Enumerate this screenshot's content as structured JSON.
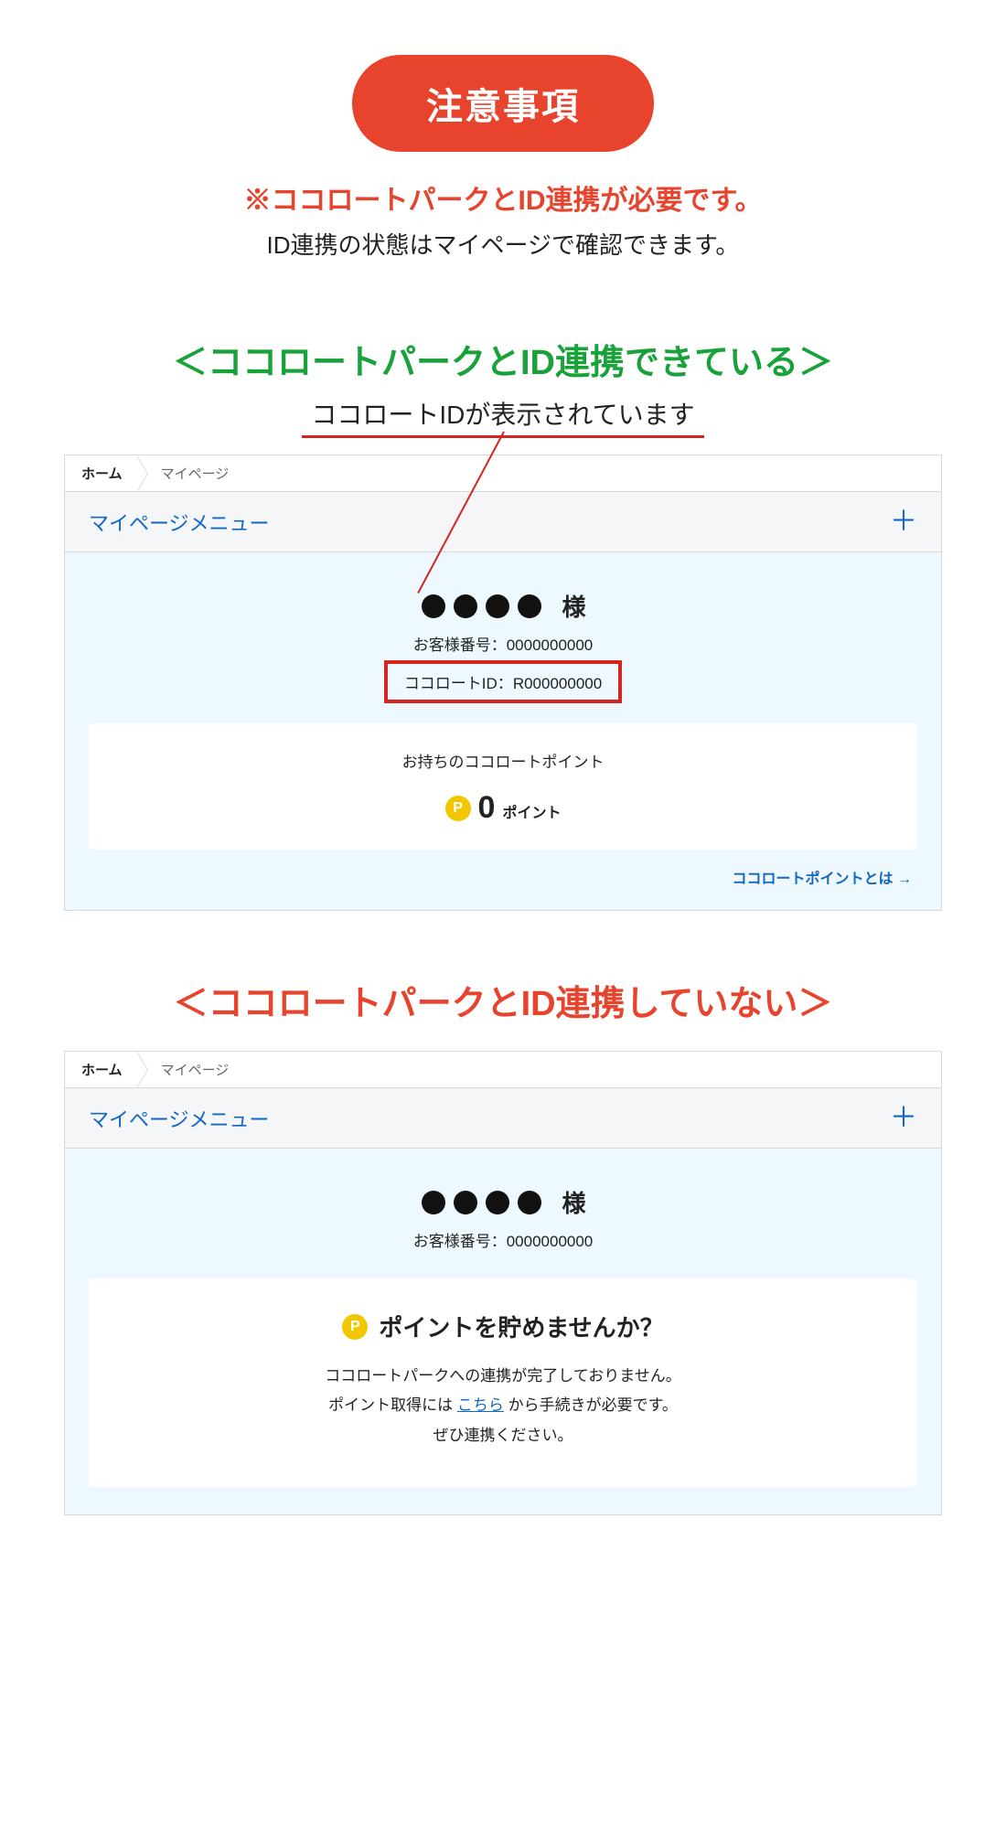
{
  "header": {
    "badge": "注意事項",
    "notice_red": "※ココロートパークとID連携が必要です。",
    "notice_black": "ID連携の状態はマイページで確認できます。"
  },
  "linked": {
    "title": "＜ココロートパークとID連携できている＞",
    "callout": "ココロートIDが表示されています",
    "breadcrumb": {
      "home": "ホーム",
      "current": "マイページ"
    },
    "menu_label": "マイページメニュー",
    "name_suffix": "様",
    "customer_number_label": "お客様番号：",
    "customer_number": "0000000000",
    "cocorohto_id_label": "ココロートID：",
    "cocorohto_id": "R000000000",
    "points_card_title": "お持ちのココロートポイント",
    "points_badge": "P",
    "points_value": "0",
    "points_unit": "ポイント",
    "points_link": "ココロートポイントとは →"
  },
  "not_linked": {
    "title": "＜ココロートパークとID連携していない＞",
    "breadcrumb": {
      "home": "ホーム",
      "current": "マイページ"
    },
    "menu_label": "マイページメニュー",
    "name_suffix": "様",
    "customer_number_label": "お客様番号：",
    "customer_number": "0000000000",
    "prompt_badge": "P",
    "prompt_title": "ポイントを貯めませんか？",
    "prompt_line1": "ココロートパークへの連携が完了しておりません。",
    "prompt_line2a": "ポイント取得には ",
    "prompt_link": "こちら",
    "prompt_line2b": " から手続きが必要です。",
    "prompt_line3": "ぜひ連携ください。"
  }
}
